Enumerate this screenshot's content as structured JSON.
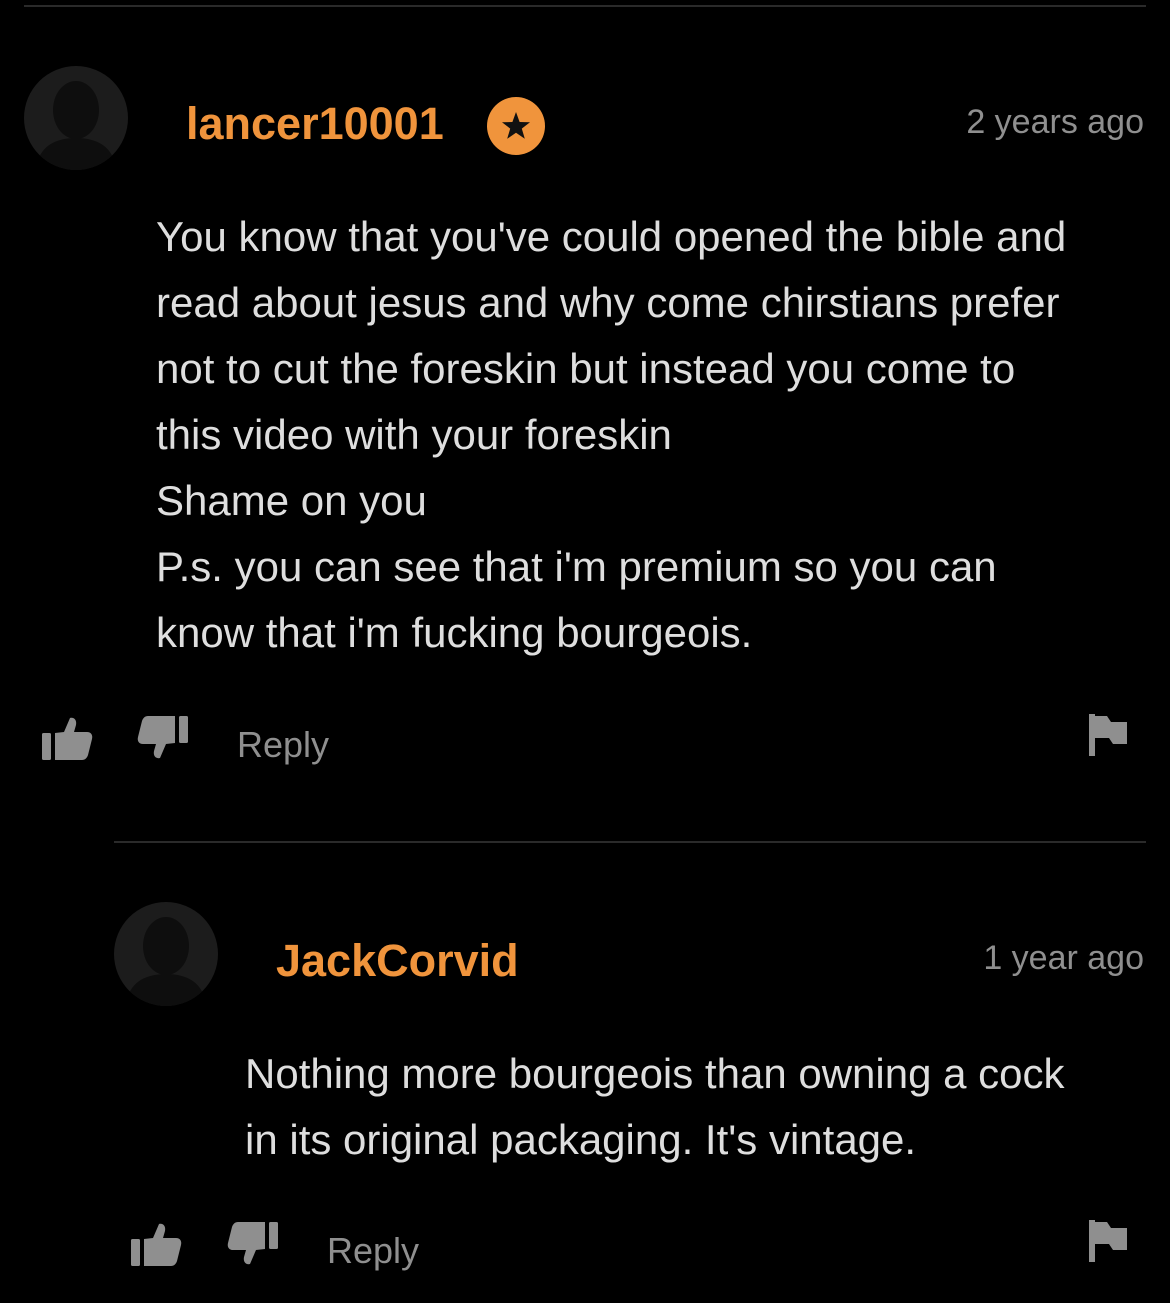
{
  "comments": [
    {
      "username": "lancer10001",
      "premium_badge_icon": "star-icon",
      "timestamp": "2 years ago",
      "body_lines": [
        "You know that you've could opened the bible and",
        "read about jesus and why come chirstians prefer",
        "not to cut the foreskin but instead you come to",
        "this video with your foreskin",
        "Shame on you",
        "P.s. you can see that i'm premium so you can",
        "know that i'm fucking bourgeois."
      ],
      "reply_label": "Reply"
    },
    {
      "username": "JackCorvid",
      "timestamp": "1 year ago",
      "body_lines": [
        "Nothing more bourgeois than owning a cock",
        "in its original packaging. It's vintage."
      ],
      "reply_label": "Reply"
    }
  ],
  "icons": {
    "avatar": "user-silhouette-icon",
    "like": "thumbs-up-icon",
    "dislike": "thumbs-down-icon",
    "report": "flag-icon"
  },
  "colors": {
    "background": "#000000",
    "username": "#f0943c",
    "body_text": "#dedede",
    "muted_text": "#8f8f8f",
    "divider": "#2a2a2a"
  }
}
